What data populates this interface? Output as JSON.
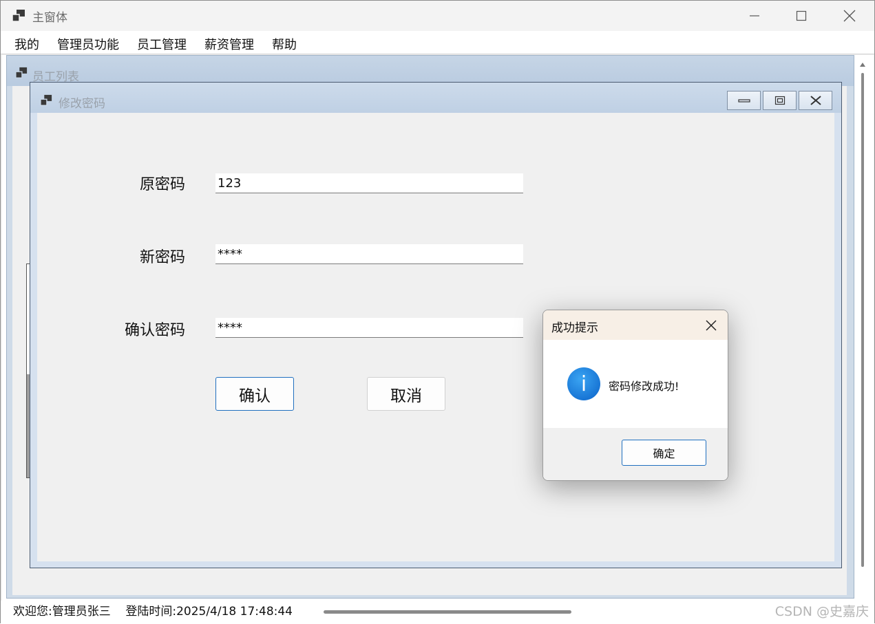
{
  "app": {
    "title": "主窗体"
  },
  "menu": {
    "items": [
      {
        "label": "我的"
      },
      {
        "label": "管理员功能"
      },
      {
        "label": "员工管理"
      },
      {
        "label": "薪资管理"
      },
      {
        "label": "帮助"
      }
    ]
  },
  "background_form": {
    "title": "员工列表"
  },
  "password_form": {
    "title": "修改密码",
    "fields": {
      "old_password": {
        "label": "原密码",
        "value": "123"
      },
      "new_password": {
        "label": "新密码",
        "value": "****"
      },
      "confirm_password": {
        "label": "确认密码",
        "value": "****"
      }
    },
    "buttons": {
      "confirm": "确认",
      "cancel": "取消"
    }
  },
  "message_box": {
    "title": "成功提示",
    "icon": "info-icon",
    "message": "密码修改成功!",
    "ok_label": "确定"
  },
  "status_bar": {
    "text": "欢迎您:管理员张三    登陆时间:2025/4/18 17:48:44"
  },
  "watermark": "CSDN @史嘉庆",
  "colors": {
    "accent": "#1f6fbf",
    "mdi_title": "#c6d5e6",
    "msgbox_title": "#f7efe6"
  }
}
